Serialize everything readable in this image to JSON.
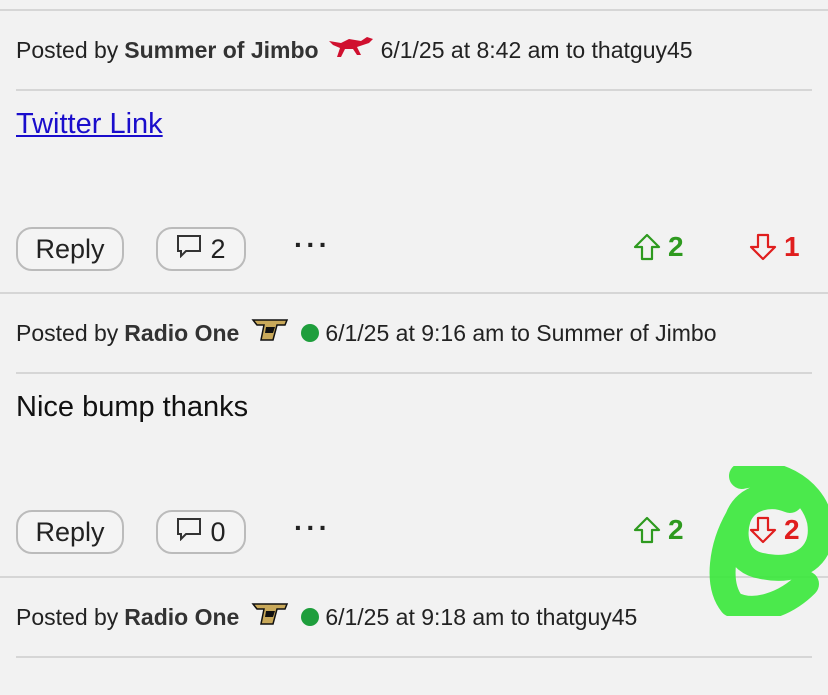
{
  "posts": [
    {
      "posted_by": "Posted by",
      "author": "Summer of Jimbo",
      "meta": "6/1/25 at 8:42 am to thatguy45",
      "body": "Twitter Link",
      "reply_label": "Reply",
      "comment_count": "2",
      "more": "···",
      "upvotes": "2",
      "downvotes": "1"
    },
    {
      "posted_by": "Posted by",
      "author": "Radio One",
      "meta": "6/1/25 at 9:16 am to Summer of Jimbo",
      "body": "Nice bump thanks",
      "reply_label": "Reply",
      "comment_count": "0",
      "more": "···",
      "upvotes": "2",
      "downvotes": "2"
    },
    {
      "posted_by": "Posted by",
      "author": "Radio One",
      "meta": "6/1/25 at 9:18 am to thatguy45"
    }
  ],
  "icons": {
    "team_logo_1": "mustang-logo-icon",
    "team_logo_2": "purdue-p-logo-icon",
    "online": "online-status-icon"
  },
  "colors": {
    "upvote": "#2e9a1f",
    "downvote": "#e01e1e",
    "link": "#1a0dcc",
    "online": "#1e9e3c",
    "annotation": "#39e83a"
  }
}
